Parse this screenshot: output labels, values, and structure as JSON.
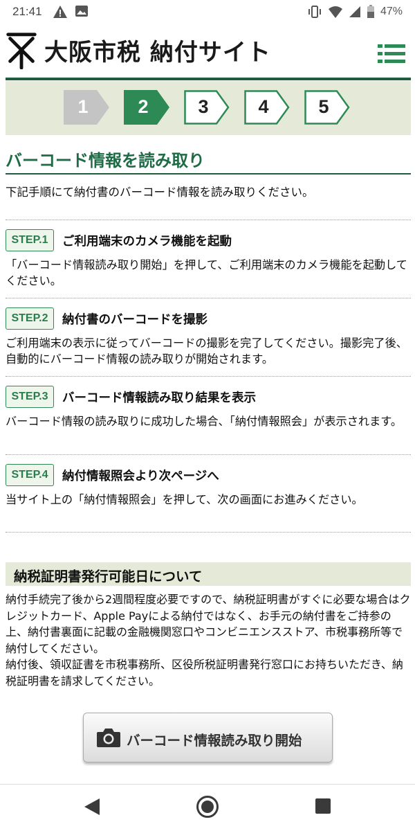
{
  "status_bar": {
    "time": "21:41",
    "battery_text": "47%",
    "left_icons": [
      "warning-icon",
      "image-icon"
    ],
    "right_icons": [
      "vibrate-icon",
      "wifi-icon",
      "signal-icon",
      "battery-icon"
    ]
  },
  "header": {
    "site_title": "大阪市税 納付サイト",
    "menu_icon": "menu-icon"
  },
  "steps": [
    {
      "number": "1",
      "state": "done"
    },
    {
      "number": "2",
      "state": "current"
    },
    {
      "number": "3",
      "state": "upcoming"
    },
    {
      "number": "4",
      "state": "upcoming"
    },
    {
      "number": "5",
      "state": "upcoming"
    }
  ],
  "main": {
    "title": "バーコード情報を読み取り",
    "intro": "下記手順にて納付書のバーコード情報を読み取りください。",
    "steps": [
      {
        "badge": "STEP.1",
        "heading": "ご利用端末のカメラ機能を起動",
        "body": "「バーコード情報読み取り開始」を押して、ご利用端末のカメラ機能を起動してください。"
      },
      {
        "badge": "STEP.2",
        "heading": "納付書のバーコードを撮影",
        "body": "ご利用端末の表示に従ってバーコードの撮影を完了してください。撮影完了後、自動的にバーコード情報の読み取りが開始されます。"
      },
      {
        "badge": "STEP.3",
        "heading": "バーコード情報読み取り結果を表示",
        "body": "バーコード情報の読み取りに成功した場合、「納付情報照会」が表示されます。"
      },
      {
        "badge": "STEP.4",
        "heading": "納付情報照会より次ページへ",
        "body": "当サイト上の「納付情報照会」を押して、次の画面にお進みください。"
      }
    ],
    "section_title": "納税証明書発行可能日について",
    "section_body_1": "納付手続完了後から2週間程度必要ですので、納税証明書がすぐに必要な場合はクレジットカード、Apple Payによる納付ではなく、お手元の納付書をご持参の上、納付書裏面に記載の金融機関窓口やコンビニエンスストア、市税事務所等で納付してください。",
    "section_body_2": "納付後、領収証書を市税事務所、区役所税証明書発行窓口にお持ちいただき、納税証明書を請求してください。",
    "start_button_label": "バーコード情報読み取り開始",
    "start_button_icon": "camera-icon"
  },
  "colors": {
    "accent_green": "#1e6b45",
    "step_current": "#2e8a55",
    "step_done": "#c4c4c4",
    "band": "#e5ead8"
  },
  "nav_bar": {
    "icons": [
      "back-icon",
      "home-icon",
      "recents-icon"
    ]
  }
}
